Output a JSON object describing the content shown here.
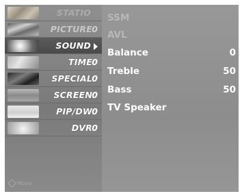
{
  "menu": {
    "items": [
      {
        "label": "STATIO",
        "suffix": "",
        "state": "faint",
        "icon": "station-thumbnail"
      },
      {
        "label": "PICTURE",
        "suffix": "0",
        "state": "dim",
        "icon": "picture-thumbnail"
      },
      {
        "label": "SOUND",
        "suffix": "",
        "state": "selected",
        "icon": "sound-thumbnail",
        "arrow": "right"
      },
      {
        "label": "TIME",
        "suffix": "0",
        "state": "normal",
        "icon": "time-thumbnail"
      },
      {
        "label": "SPECIAL",
        "suffix": "0",
        "state": "normal",
        "icon": "special-thumbnail"
      },
      {
        "label": "SCREEN",
        "suffix": "0",
        "state": "normal",
        "icon": "screen-thumbnail"
      },
      {
        "label": "PIP/DW",
        "suffix": "0",
        "state": "normal",
        "icon": "pip-dw-thumbnail"
      },
      {
        "label": "DVR",
        "suffix": "0",
        "state": "normal",
        "icon": "dvr-thumbnail"
      }
    ],
    "hint": "Move"
  },
  "sound": {
    "rows": [
      {
        "label": "SSM",
        "value": "",
        "enabled": false
      },
      {
        "label": "AVL",
        "value": "",
        "enabled": false
      },
      {
        "label": "Balance",
        "value": "0",
        "enabled": true
      },
      {
        "label": "Treble",
        "value": "50",
        "enabled": true
      },
      {
        "label": "Bass",
        "value": "50",
        "enabled": true
      },
      {
        "label": "TV Speaker",
        "value": "",
        "enabled": true
      }
    ]
  },
  "colors": {
    "panel_left": "#7f7f7f",
    "panel_right": "#929292",
    "text": "#ffffff",
    "text_disabled": "#b8b8b8"
  }
}
